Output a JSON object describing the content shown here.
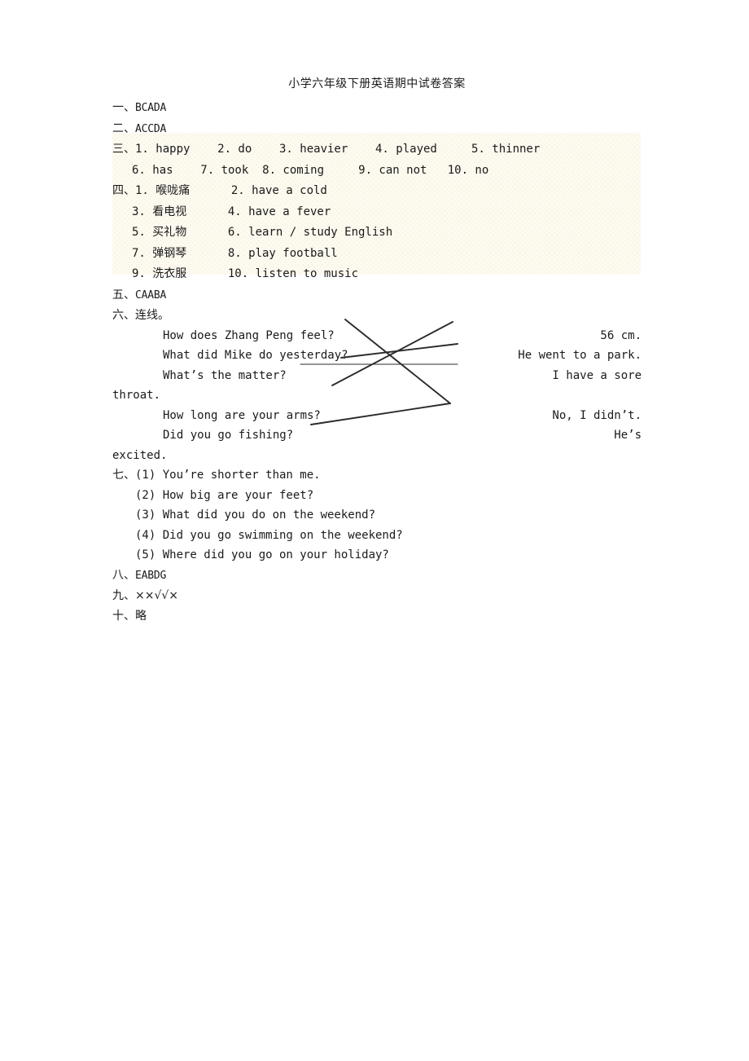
{
  "document": {
    "title": "小学六年级下册英语期中试卷答案",
    "page_background": "#ffffff",
    "highlight_color": "#fdfaf0",
    "text_color": "#1a1a1a"
  },
  "sections": {
    "one": {
      "label": "一、",
      "answer": "BCADA"
    },
    "two": {
      "label": "二、",
      "answer": "ACCDA"
    },
    "three": {
      "label": "三、",
      "line1": "1. happy    2. do    3. heavier    4. played     5. thinner",
      "line2": "6. has    7. took  8. coming     9. can not   10. no",
      "items": [
        {
          "num": "1.",
          "value": "happy"
        },
        {
          "num": "2.",
          "value": "do"
        },
        {
          "num": "3.",
          "value": "heavier"
        },
        {
          "num": "4.",
          "value": "played"
        },
        {
          "num": "5.",
          "value": "thinner"
        },
        {
          "num": "6.",
          "value": "has"
        },
        {
          "num": "7.",
          "value": "took"
        },
        {
          "num": "8.",
          "value": "coming"
        },
        {
          "num": "9.",
          "value": "can not"
        },
        {
          "num": "10.",
          "value": "no"
        }
      ]
    },
    "four": {
      "label": "四、",
      "line1": "1. 喉咙痛      2. have a cold",
      "line2": "3. 看电视      4. have a fever",
      "line3": "5. 买礼物      6. learn / study English",
      "line4": "7. 弹钢琴      8. play football",
      "line5": "9. 洗衣服      10. listen to music",
      "items": [
        {
          "num": "1.",
          "value": "喉咙痛"
        },
        {
          "num": "2.",
          "value": "have a cold"
        },
        {
          "num": "3.",
          "value": "看电视"
        },
        {
          "num": "4.",
          "value": "have a fever"
        },
        {
          "num": "5.",
          "value": "买礼物"
        },
        {
          "num": "6.",
          "value": "learn / study English"
        },
        {
          "num": "7.",
          "value": "弹钢琴"
        },
        {
          "num": "8.",
          "value": "play football"
        },
        {
          "num": "9.",
          "value": "洗衣服"
        },
        {
          "num": "10.",
          "value": "listen to music"
        }
      ]
    },
    "five": {
      "label": "五、",
      "answer": "CAABA"
    },
    "six": {
      "label": "六、",
      "instruction": "连线。",
      "left_items": [
        "How does Zhang Peng feel?",
        "What did Mike do yesterday?",
        "What’s the matter?",
        "How long are your arms?",
        "Did you go fishing?"
      ],
      "right_items": [
        "56 cm.",
        "He went to a park.",
        "I have a sore",
        "No, I didn’t.",
        "He’s"
      ],
      "wrap_line_1": "throat.",
      "wrap_line_2": "excited."
    },
    "seven": {
      "label": "七、",
      "items": [
        {
          "num": "(1)",
          "value": "You’re shorter than me."
        },
        {
          "num": "(2)",
          "value": "How big are your feet?"
        },
        {
          "num": "(3)",
          "value": "What did you do on the weekend?"
        },
        {
          "num": "(4)",
          "value": "Did you go swimming on the weekend?"
        },
        {
          "num": "(5)",
          "value": "Where did you go on your holiday?"
        }
      ],
      "line1": "(1) You’re shorter than me.",
      "line2": "(2) How big are your feet?",
      "line3": "(3) What did you do on the weekend?",
      "line4": "(4) Did you go swimming on the weekend?",
      "line5": "(5) Where did you go on your holiday?"
    },
    "eight": {
      "label": "八、",
      "answer": "EABDG"
    },
    "nine": {
      "label": "九、",
      "answer": "××√√×"
    },
    "ten": {
      "label": "十、",
      "answer": "略"
    }
  }
}
